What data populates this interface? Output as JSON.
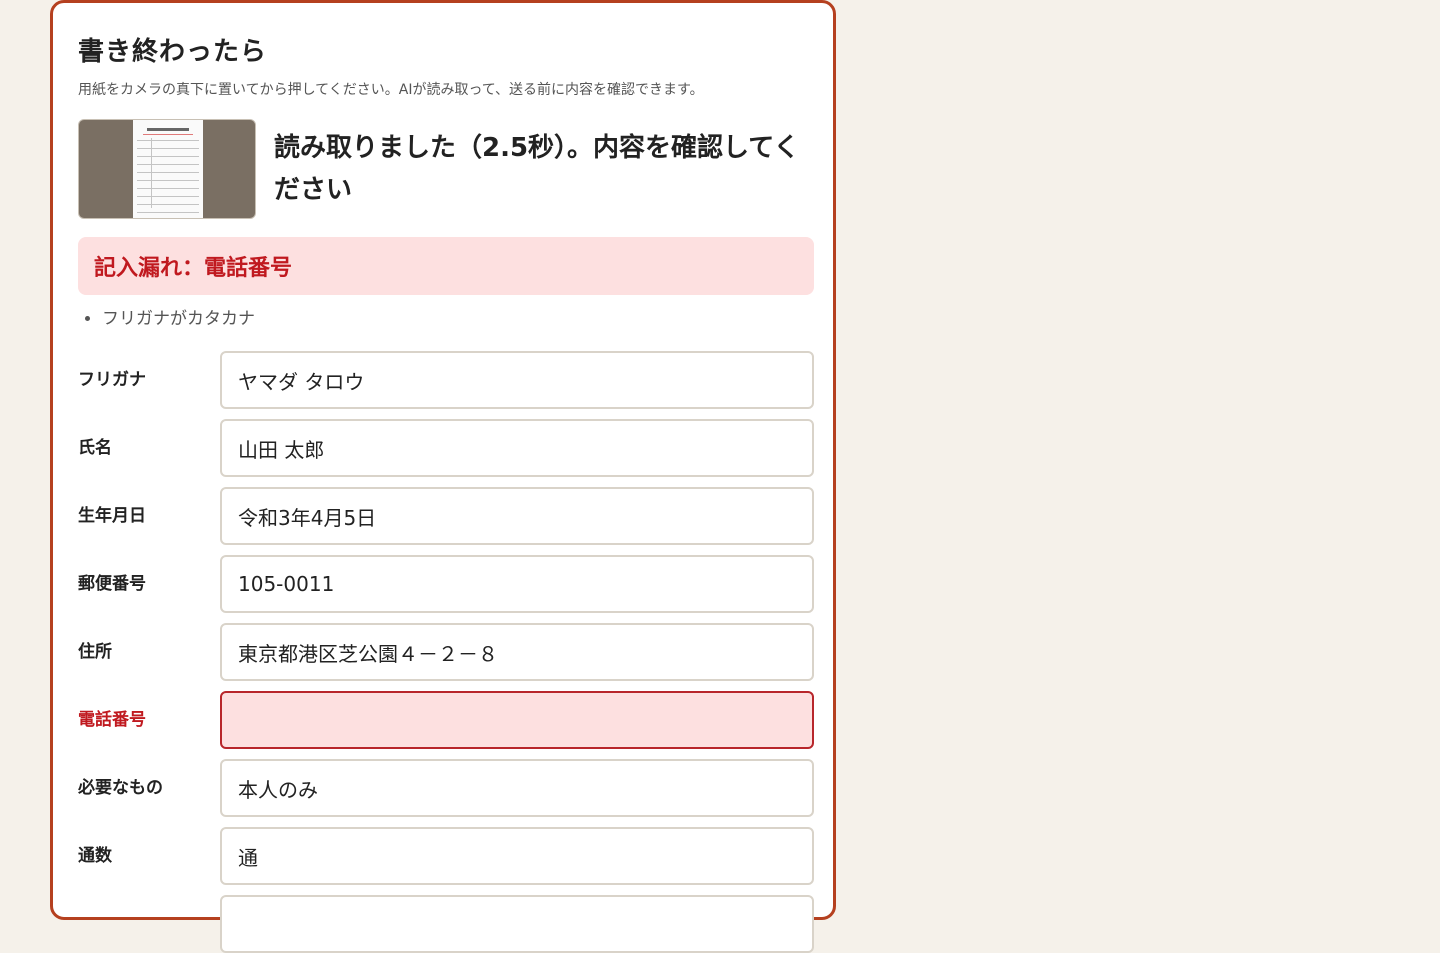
{
  "section": {
    "title": "書き終わったら",
    "subtitle": "用紙をカメラの真下に置いてから押してください。AIが読み取って、送る前に内容を確認できます。"
  },
  "scan": {
    "thumbnail_icon": "scanned-form-thumbnail",
    "status": "読み取りました（2.5秒）。内容を確認してください"
  },
  "alert": {
    "text": "記入漏れ：電話番号"
  },
  "notes": [
    "フリガナがカタカナ"
  ],
  "fields": [
    {
      "label": "フリガナ",
      "value": "ヤマダ タロウ"
    },
    {
      "label": "氏名",
      "value": "山田 太郎"
    },
    {
      "label": "生年月日",
      "value": "令和3年4月5日"
    },
    {
      "label": "郵便番号",
      "value": "105-0011"
    },
    {
      "label": "住所",
      "value": "東京都港区芝公園４－２－８"
    },
    {
      "label": "電話番号",
      "value": "",
      "error": true
    },
    {
      "label": "必要なもの",
      "value": "本人のみ"
    },
    {
      "label": "通数",
      "value": "通"
    }
  ],
  "colors": {
    "accent_border": "#b5401f",
    "error_text": "#c0191f",
    "error_background": "#fde0e0",
    "page_background": "#f5f1ea"
  }
}
